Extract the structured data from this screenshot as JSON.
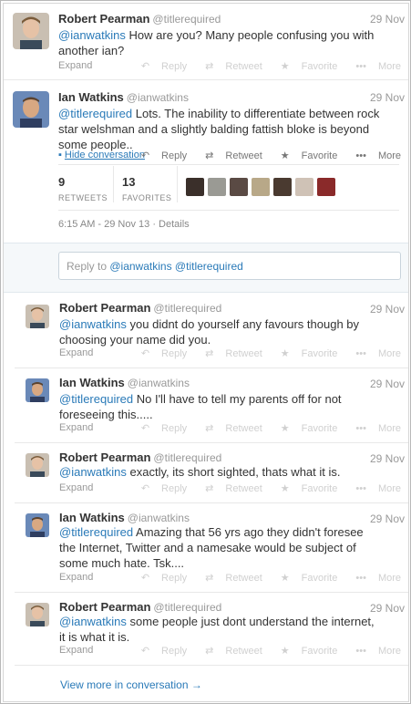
{
  "tweets": [
    {
      "fullname": "Robert Pearman",
      "handle": "@titlerequired",
      "time": "29 Nov",
      "mention": "@ianwatkins",
      "body": " How are you? Many people confusing you with another ian?",
      "expand": "Expand"
    },
    {
      "fullname": "Ian Watkins",
      "handle": "@ianwatkins",
      "time": "29 Nov",
      "mention": "@titlerequired",
      "body": " Lots. The inability to differentiate between rock star welshman and a slightly balding fattish bloke is beyond some people..",
      "hide_conversation": "Hide conversation"
    },
    {
      "fullname": "Robert Pearman",
      "handle": "@titlerequired",
      "time": "29 Nov",
      "mention": "@ianwatkins",
      "body": " you didnt do yourself any favours though by choosing your name did you.",
      "expand": "Expand"
    },
    {
      "fullname": "Ian Watkins",
      "handle": "@ianwatkins",
      "time": "29 Nov",
      "mention": "@titlerequired",
      "body": " No I'll have to tell my parents off for not foreseeing this.....",
      "expand": "Expand"
    },
    {
      "fullname": "Robert Pearman",
      "handle": "@titlerequired",
      "time": "29 Nov",
      "mention": "@ianwatkins",
      "body": " exactly, its short sighted, thats what it is.",
      "expand": "Expand"
    },
    {
      "fullname": "Ian Watkins",
      "handle": "@ianwatkins",
      "time": "29 Nov",
      "mention": "@titlerequired",
      "body": " Amazing that 56 yrs ago they didn't foresee the Internet, Twitter and a namesake would be subject of some much hate. Tsk....",
      "expand": "Expand"
    },
    {
      "fullname": "Robert Pearman",
      "handle": "@titlerequired",
      "time": "29 Nov",
      "mention": "@ianwatkins",
      "body": " some people just dont understand the internet, it is what it is.",
      "expand": "Expand"
    }
  ],
  "actions": {
    "reply": "Reply",
    "retweet": "Retweet",
    "favorite": "Favorite",
    "more": "More"
  },
  "stats": {
    "retweets_count": "9",
    "retweets_label": "RETWEETS",
    "favorites_count": "13",
    "favorites_label": "FAVORITES"
  },
  "detail_time": "6:15 AM - 29 Nov 13 · Details",
  "reply_box": {
    "prefix": "Reply to ",
    "mention1": "@ianwatkins",
    "mention2": "@titlerequired"
  },
  "view_more": "View more in conversation →",
  "colors": {
    "link": "#2a7ab8",
    "muted": "#999999",
    "conversation_bg": "#f5f8fa"
  }
}
